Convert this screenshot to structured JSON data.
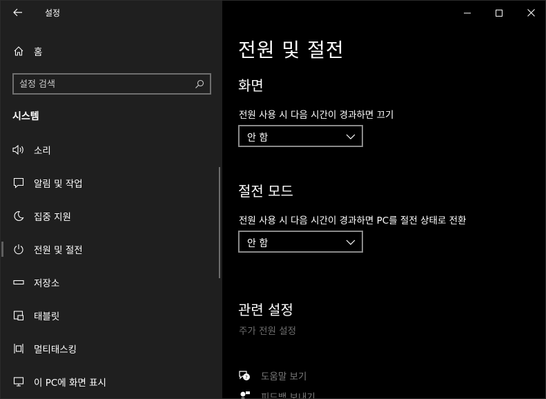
{
  "window": {
    "app_title": "설정",
    "controls": [
      "minimize-icon",
      "maximize-icon",
      "close-icon"
    ]
  },
  "sidebar": {
    "home_label": "홈",
    "search_placeholder": "설정 검색",
    "section_label": "시스템",
    "items": [
      {
        "label": "소리",
        "icon": "speaker-icon"
      },
      {
        "label": "알림 및 작업",
        "icon": "notification-icon"
      },
      {
        "label": "집중 지원",
        "icon": "moon-icon"
      },
      {
        "label": "전원 및 절전",
        "icon": "power-icon",
        "selected": true
      },
      {
        "label": "저장소",
        "icon": "storage-icon"
      },
      {
        "label": "태블릿",
        "icon": "tablet-icon"
      },
      {
        "label": "멀티태스킹",
        "icon": "multitasking-icon"
      },
      {
        "label": "이 PC에 화면 표시",
        "icon": "project-icon"
      }
    ]
  },
  "main": {
    "page_title": "전원 및 절전",
    "screen": {
      "heading": "화면",
      "description": "전원 사용 시 다음 시간이 경과하면 끄기",
      "value": "안 함"
    },
    "sleep": {
      "heading": "절전 모드",
      "description": "전원 사용 시 다음 시간이 경과하면 PC를 절전 상태로 전환",
      "value": "안 함"
    },
    "related": {
      "heading": "관련 설정",
      "link": "주가 전원 설정"
    },
    "help": {
      "get_help": "도움말 보기",
      "feedback": "피드백 보내기"
    }
  },
  "colors": {
    "sidebar_bg": "#1f1f1f",
    "main_bg": "#000000",
    "selected_indicator": "#5f5f5f",
    "disabled_text": "#6e6e6e"
  }
}
